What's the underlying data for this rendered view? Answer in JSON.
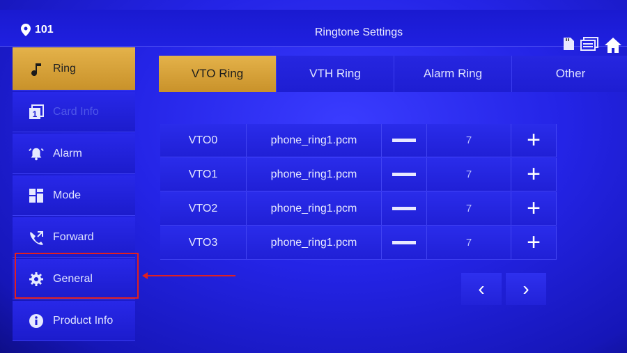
{
  "header": {
    "room_number": "101",
    "title": "Ringtone Settings",
    "icons": [
      "sd-card-icon",
      "messages-icon",
      "home-icon"
    ]
  },
  "sidebar": {
    "items": [
      {
        "label": "Ring",
        "icon": "music-note-icon",
        "state": "active"
      },
      {
        "label": "Card Info",
        "icon": "card-icon",
        "state": "disabled"
      },
      {
        "label": "Alarm",
        "icon": "alarm-bell-icon",
        "state": "normal"
      },
      {
        "label": "Mode",
        "icon": "grid-icon",
        "state": "normal"
      },
      {
        "label": "Forward",
        "icon": "phone-forward-icon",
        "state": "normal"
      },
      {
        "label": "General",
        "icon": "gear-icon",
        "state": "normal"
      },
      {
        "label": "Product Info",
        "icon": "info-icon",
        "state": "normal"
      }
    ]
  },
  "tabs": [
    {
      "label": "VTO Ring",
      "active": true
    },
    {
      "label": "VTH Ring",
      "active": false
    },
    {
      "label": "Alarm Ring",
      "active": false
    },
    {
      "label": "Other",
      "active": false
    }
  ],
  "ring_table": {
    "rows": [
      {
        "device": "VTO0",
        "file": "phone_ring1.pcm",
        "volume": "7"
      },
      {
        "device": "VTO1",
        "file": "phone_ring1.pcm",
        "volume": "7"
      },
      {
        "device": "VTO2",
        "file": "phone_ring1.pcm",
        "volume": "7"
      },
      {
        "device": "VTO3",
        "file": "phone_ring1.pcm",
        "volume": "7"
      }
    ],
    "plus_symbol": "+"
  },
  "pager": {
    "prev": "‹",
    "next": "›"
  },
  "colors": {
    "accent": "#d9a23a",
    "background": "#2424e6",
    "annotation": "#e02020"
  }
}
